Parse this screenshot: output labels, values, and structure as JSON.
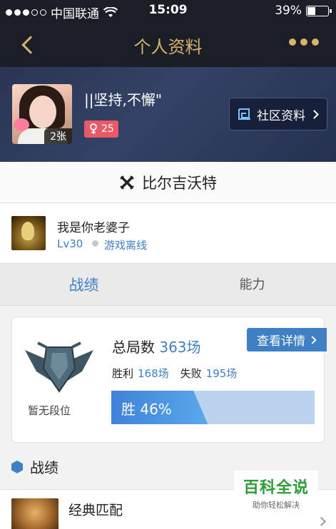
{
  "status_bar": {
    "carrier": "中国联通",
    "time": "15:09",
    "battery": "39%"
  },
  "nav": {
    "title": "个人资料"
  },
  "profile": {
    "photo_count": "2张",
    "signature": "||坚持,不懈\"",
    "popularity": "25",
    "community_button": "社区资料"
  },
  "server": {
    "name": "比尔吉沃特"
  },
  "role": {
    "name": "我是你老婆子",
    "level": "Lv30",
    "status": "游戏离线"
  },
  "tabs": [
    {
      "label": "战绩",
      "active": true
    },
    {
      "label": "能力",
      "active": false
    }
  ],
  "stats": {
    "rank": "暂无段位",
    "total_label": "总局数",
    "total": "363场",
    "win_label": "胜利",
    "wins": "168场",
    "loss_label": "失败",
    "losses": "195场",
    "win_rate": 46,
    "win_rate_text": "胜 46%",
    "detail_button": "查看详情"
  },
  "section": {
    "title": "战绩"
  },
  "match": {
    "mode": "经典匹配"
  },
  "watermark": {
    "title": "百科全说",
    "subtitle": "助你轻松解决"
  },
  "colors": {
    "accent": "#3f7fc4",
    "gold": "#d7b46e",
    "badge": "#e85a68"
  }
}
